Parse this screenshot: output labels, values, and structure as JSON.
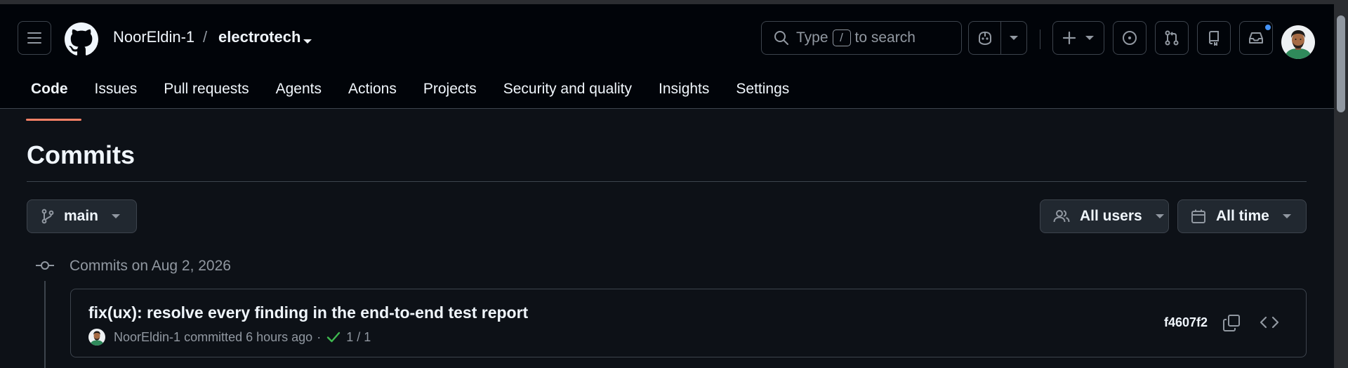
{
  "header": {
    "owner": "NoorEldin-1",
    "separator": "/",
    "repo": "electrotech",
    "search": {
      "prefix": "Type",
      "key": "/",
      "suffix": "to search"
    }
  },
  "tabs": [
    {
      "label": "Code",
      "active": true
    },
    {
      "label": "Issues"
    },
    {
      "label": "Pull requests"
    },
    {
      "label": "Agents"
    },
    {
      "label": "Actions"
    },
    {
      "label": "Projects"
    },
    {
      "label": "Security and quality"
    },
    {
      "label": "Insights"
    },
    {
      "label": "Settings"
    }
  ],
  "page": {
    "title": "Commits",
    "branch": "main",
    "users_filter": "All users",
    "time_filter": "All time"
  },
  "commit_group": {
    "label": "Commits on Aug 2, 2026",
    "commits": [
      {
        "message": "fix(ux): resolve every finding in the end-to-end test report",
        "author": "NoorEldin-1",
        "verb": "committed",
        "time": "6 hours ago",
        "separator": "·",
        "checks": "1 / 1",
        "sha": "f4607f2"
      }
    ]
  },
  "colors": {
    "background": "#0d1117",
    "header_bg": "#010409",
    "border": "#3d444d",
    "active_tab_underline": "#f78166",
    "check_green": "#3fb950",
    "notification_dot": "#4493f8",
    "muted_text": "#9198a1"
  },
  "icons": [
    "hamburger-icon",
    "github-logo",
    "search-icon",
    "copilot-icon",
    "plus-icon",
    "issue-icon",
    "pull-request-icon",
    "repo-icon",
    "inbox-icon",
    "git-branch-icon",
    "people-icon",
    "calendar-icon",
    "git-commit-icon",
    "check-icon",
    "copy-icon",
    "code-icon"
  ]
}
